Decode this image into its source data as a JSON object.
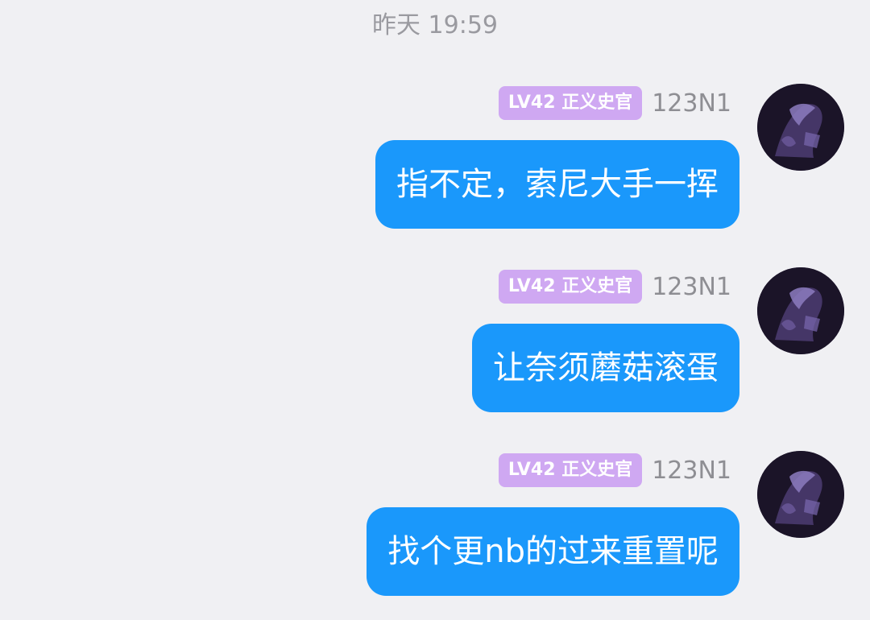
{
  "chat": {
    "timestamp": "昨天 19:59",
    "messages": [
      {
        "badge": "LV42 正义史官",
        "username": "123N1",
        "text": "指不定，索尼大手一挥"
      },
      {
        "badge": "LV42 正义史官",
        "username": "123N1",
        "text": "让奈须蘑菇滚蛋"
      },
      {
        "badge": "LV42 正义史官",
        "username": "123N1",
        "text": "找个更nb的过来重置呢"
      }
    ]
  },
  "colors": {
    "background": "#f0f0f3",
    "bubble": "#1a98fb",
    "badge": "#cfa8f2",
    "timestamp_text": "#9a9aa0",
    "username_text": "#8e8e93"
  },
  "icons": {
    "avatar": "dark-purple-anime-avatar"
  }
}
